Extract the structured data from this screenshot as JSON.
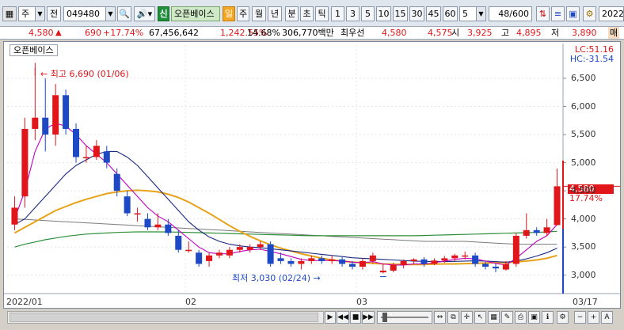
{
  "toolbar": {
    "market": "주",
    "jeon": "전",
    "code": "049480",
    "badge_sin": "신",
    "stock_name": "오픈베이스",
    "periods": [
      "일",
      "주",
      "월",
      "년",
      "분",
      "초",
      "틱"
    ],
    "intervals": [
      "1",
      "3",
      "5",
      "10",
      "15",
      "30",
      "45",
      "60"
    ],
    "interval_selected": "5",
    "count": "48",
    "count_max": "/600",
    "year": "2022"
  },
  "quote": {
    "price": "4,580",
    "arrow": "▲",
    "change": "690",
    "change_pct": "+17.74%",
    "volume": "67,456,642",
    "volume_ratio": "1,242.55%",
    "turnover": "14.68%",
    "amount": "306,770백만",
    "best_ask_label": "최우선",
    "best_ask": "4,580",
    "best_bid": "4,575",
    "open_label": "시",
    "open": "3,925",
    "high_label": "고",
    "high": "4,895",
    "low_label": "저",
    "low": "3,890",
    "trailing": "매"
  },
  "chart": {
    "stock_name": "오픈베이스",
    "lc": "LC:51.16",
    "hc": "HC:-31.54",
    "last_price": "4,580",
    "last_pct": "17.74%",
    "high_annotation": "최고 6,690 (01/06)",
    "low_annotation": "최저 3,030 (02/24)",
    "x_labels": [
      "2022/01",
      "02",
      "03",
      "03/17"
    ],
    "colors": {
      "up": "#e0161b",
      "down": "#1d49c4",
      "ma5": "#c000c0",
      "ma20": "#1a2a80",
      "ma60": "#e8a21a",
      "ma120": "#2c8f3a",
      "ma240": "#7a7a7a"
    }
  },
  "chart_data": {
    "type": "candlestick",
    "y_ticks": [
      "6,500",
      "6,000",
      "5,500",
      "5,000",
      "4,500",
      "4,000",
      "3,500",
      "3,000"
    ],
    "ylim": [
      2700,
      6950
    ],
    "candles": [
      [
        3900,
        4200,
        4400,
        3800
      ],
      [
        4400,
        5600,
        5800,
        4200
      ],
      [
        5600,
        5800,
        6690,
        5400
      ],
      [
        5800,
        5500,
        6500,
        5200
      ],
      [
        5500,
        6200,
        6400,
        5300
      ],
      [
        6200,
        5600,
        6300,
        5500
      ],
      [
        5600,
        5100,
        5700,
        5000
      ],
      [
        5100,
        5100,
        5300,
        5000
      ],
      [
        5100,
        5300,
        5400,
        5050
      ],
      [
        5200,
        5000,
        5300,
        4900
      ],
      [
        4800,
        4500,
        4900,
        4400
      ],
      [
        4400,
        4100,
        4500,
        4050
      ],
      [
        4100,
        4100,
        4200,
        3950
      ],
      [
        4000,
        3850,
        4100,
        3800
      ],
      [
        3850,
        3900,
        4100,
        3800
      ],
      [
        3900,
        3750,
        4000,
        3700
      ],
      [
        3700,
        3450,
        3800,
        3400
      ],
      [
        3450,
        3450,
        3600,
        3400
      ],
      [
        3400,
        3200,
        3450,
        3150
      ],
      [
        3250,
        3350,
        3400,
        3150
      ],
      [
        3350,
        3400,
        3450,
        3300
      ],
      [
        3350,
        3450,
        3500,
        3300
      ],
      [
        3450,
        3500,
        3550,
        3400
      ],
      [
        3450,
        3500,
        3550,
        3400
      ],
      [
        3500,
        3550,
        3600,
        3450
      ],
      [
        3550,
        3200,
        3600,
        3150
      ],
      [
        3300,
        3250,
        3400,
        3200
      ],
      [
        3250,
        3200,
        3300,
        3150
      ],
      [
        3200,
        3250,
        3300,
        3100
      ],
      [
        3250,
        3300,
        3350,
        3200
      ],
      [
        3300,
        3250,
        3350,
        3200
      ],
      [
        3250,
        3280,
        3350,
        3200
      ],
      [
        3280,
        3200,
        3320,
        3150
      ],
      [
        3200,
        3150,
        3250,
        3100
      ],
      [
        3150,
        3250,
        3300,
        3100
      ],
      [
        3250,
        3350,
        3400,
        3200
      ],
      [
        3050,
        3080,
        3200,
        3030
      ],
      [
        3080,
        3180,
        3220,
        3050
      ],
      [
        3180,
        3250,
        3280,
        3120
      ],
      [
        3250,
        3280,
        3300,
        3200
      ],
      [
        3280,
        3200,
        3320,
        3150
      ],
      [
        3200,
        3260,
        3300,
        3180
      ],
      [
        3260,
        3300,
        3340,
        3220
      ],
      [
        3300,
        3350,
        3380,
        3250
      ],
      [
        3350,
        3350,
        3420,
        3280
      ],
      [
        3350,
        3200,
        3400,
        3150
      ],
      [
        3200,
        3150,
        3250,
        3100
      ],
      [
        3150,
        3120,
        3200,
        3050
      ],
      [
        3100,
        3200,
        3250,
        3080
      ],
      [
        3200,
        3700,
        3750,
        3150
      ],
      [
        3700,
        3800,
        4100,
        3650
      ],
      [
        3800,
        3750,
        3850,
        3700
      ],
      [
        3750,
        3850,
        4000,
        3700
      ],
      [
        3890,
        4580,
        4895,
        3890
      ]
    ],
    "ma5": [
      4000,
      4500,
      5200,
      5600,
      5700,
      5650,
      5500,
      5300,
      5150,
      5000,
      4800,
      4600,
      4400,
      4200,
      4050,
      3950,
      3800,
      3650,
      3500,
      3400,
      3380,
      3380,
      3420,
      3450,
      3460,
      3420,
      3380,
      3330,
      3280,
      3260,
      3260,
      3260,
      3250,
      3230,
      3220,
      3240,
      3200,
      3180,
      3180,
      3200,
      3200,
      3220,
      3250,
      3280,
      3300,
      3290,
      3250,
      3210,
      3180,
      3300,
      3450,
      3600,
      3700,
      3900
    ],
    "ma20": [
      3900,
      4000,
      4200,
      4400,
      4600,
      4800,
      4950,
      5050,
      5150,
      5200,
      5200,
      5100,
      4950,
      4750,
      4550,
      4350,
      4150,
      3950,
      3800,
      3680,
      3600,
      3550,
      3520,
      3500,
      3490,
      3470,
      3450,
      3430,
      3410,
      3390,
      3370,
      3350,
      3330,
      3310,
      3300,
      3290,
      3280,
      3270,
      3260,
      3250,
      3245,
      3240,
      3240,
      3245,
      3250,
      3255,
      3250,
      3240,
      3230,
      3250,
      3290,
      3340,
      3400,
      3480
    ],
    "ma60": [
      3750,
      3850,
      3950,
      4050,
      4150,
      4220,
      4290,
      4350,
      4400,
      4450,
      4480,
      4500,
      4510,
      4500,
      4480,
      4440,
      4380,
      4300,
      4200,
      4100,
      3990,
      3880,
      3780,
      3690,
      3610,
      3540,
      3480,
      3430,
      3380,
      3340,
      3300,
      3270,
      3250,
      3230,
      3220,
      3210,
      3200,
      3195,
      3190,
      3190,
      3190,
      3195,
      3200,
      3200,
      3205,
      3210,
      3215,
      3220,
      3225,
      3235,
      3250,
      3270,
      3300,
      3350
    ],
    "ma120": [
      3500,
      3550,
      3590,
      3630,
      3660,
      3690,
      3710,
      3730,
      3740,
      3750,
      3760,
      3765,
      3770,
      3770,
      3770,
      3768,
      3765,
      3760,
      3755,
      3750,
      3745,
      3740,
      3735,
      3730,
      3725,
      3720,
      3715,
      3710,
      3705,
      3700,
      3700,
      3700,
      3700,
      3700,
      3700,
      3700,
      3700,
      3700,
      3700,
      3700,
      3705,
      3710,
      3715,
      3720,
      3725,
      3730,
      3735,
      3740,
      3745,
      3750,
      3755,
      3760,
      3770,
      3780
    ],
    "ma240": [
      4000,
      3990,
      3980,
      3970,
      3960,
      3950,
      3940,
      3930,
      3920,
      3910,
      3900,
      3890,
      3880,
      3870,
      3860,
      3850,
      3840,
      3830,
      3820,
      3810,
      3800,
      3790,
      3780,
      3770,
      3760,
      3750,
      3740,
      3730,
      3720,
      3710,
      3700,
      3690,
      3680,
      3670,
      3660,
      3650,
      3640,
      3630,
      3620,
      3610,
      3600,
      3600,
      3600,
      3600,
      3600,
      3590,
      3580,
      3570,
      3560,
      3550,
      3550,
      3550,
      3550,
      3550
    ]
  },
  "nav": {
    "play": "▶",
    "rewind": "◀◀",
    "stop": "■",
    "forward": "▶▶",
    "zoom_out": "−",
    "zoom_in": "+",
    "auto": "A"
  }
}
